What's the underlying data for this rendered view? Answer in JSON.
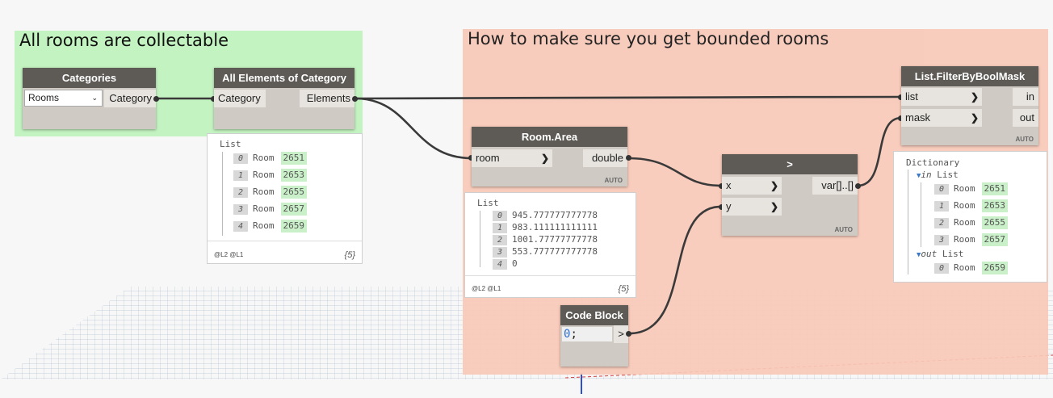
{
  "groups": {
    "left": {
      "title": "All rooms are collectable",
      "color": "#c3f3c0"
    },
    "right": {
      "title": "How to make sure you get bounded rooms",
      "color": "#f9c9b7"
    }
  },
  "nodes": {
    "categories": {
      "title": "Categories",
      "dropdown_value": "Rooms",
      "output": "Category",
      "dropdown_icon": "chevron-down-icon"
    },
    "all_elements": {
      "title": "All Elements of Category",
      "input": "Category",
      "output": "Elements"
    },
    "room_area": {
      "title": "Room.Area",
      "input": "room",
      "output": "double",
      "lacing": "AUTO"
    },
    "greater": {
      "title": ">",
      "inputs": [
        "x",
        "y"
      ],
      "output": "var[]..[]",
      "lacing": "AUTO"
    },
    "filter": {
      "title": "List.FilterByBoolMask",
      "inputs": [
        "list",
        "mask"
      ],
      "outputs": [
        "in",
        "out"
      ],
      "lacing": "AUTO"
    },
    "code_block": {
      "title": "Code Block",
      "code_number": "0",
      "code_semicolon": ";",
      "output": ">"
    }
  },
  "previews": {
    "elements": {
      "header": "List",
      "items": [
        {
          "index": "0",
          "label": "Room",
          "value": "2651"
        },
        {
          "index": "1",
          "label": "Room",
          "value": "2653"
        },
        {
          "index": "2",
          "label": "Room",
          "value": "2655"
        },
        {
          "index": "3",
          "label": "Room",
          "value": "2657"
        },
        {
          "index": "4",
          "label": "Room",
          "value": "2659"
        }
      ],
      "levels": "@L2 @L1",
      "count": "{5}"
    },
    "areas": {
      "header": "List",
      "items": [
        {
          "index": "0",
          "value": "945.777777777778"
        },
        {
          "index": "1",
          "value": "983.111111111111"
        },
        {
          "index": "2",
          "value": "1001.77777777778"
        },
        {
          "index": "3",
          "value": "553.777777777778"
        },
        {
          "index": "4",
          "value": "0"
        }
      ],
      "levels": "@L2 @L1",
      "count": "{5}"
    },
    "filter": {
      "header": "Dictionary",
      "in_key": "in",
      "in_type": "List",
      "in_items": [
        {
          "index": "0",
          "label": "Room",
          "value": "2651"
        },
        {
          "index": "1",
          "label": "Room",
          "value": "2653"
        },
        {
          "index": "2",
          "label": "Room",
          "value": "2655"
        },
        {
          "index": "3",
          "label": "Room",
          "value": "2657"
        }
      ],
      "out_key": "out",
      "out_type": "List",
      "out_items": [
        {
          "index": "0",
          "label": "Room",
          "value": "2659"
        }
      ]
    }
  }
}
